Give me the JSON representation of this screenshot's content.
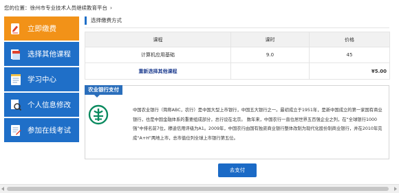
{
  "breadcrumb": {
    "label": "您的位置：",
    "current": "徐州市专业技术人员继续教育平台",
    "chevron": "›"
  },
  "sidebar": {
    "items": [
      {
        "label": "立即缴费",
        "icon": "pay-note-icon",
        "active": true
      },
      {
        "label": "选择其他课程",
        "icon": "book-icon",
        "active": false
      },
      {
        "label": "学习中心",
        "icon": "notes-icon",
        "active": false
      },
      {
        "label": "个人信息修改",
        "icon": "user-search-icon",
        "active": false
      },
      {
        "label": "参加在线考试",
        "icon": "exam-paper-icon",
        "active": false
      }
    ]
  },
  "main": {
    "section_title": "选择缴费方式",
    "table": {
      "headers": [
        "课程",
        "课时",
        "价格"
      ],
      "rows": [
        {
          "course": "计算机应用基础",
          "hours": "9.0",
          "price": "45"
        }
      ],
      "reselect_label": "重新选择其他课程",
      "total": "¥5.00"
    },
    "bank": {
      "tab_label": "农业银行支付",
      "logo_icon": "abc-bank-logo-icon",
      "description": "中国农业银行（简称ABC，农行）是中国大型上市银行，中国五大银行之一。最初成立于1951年，是新中国成立的第一家国有商业银行，也是中国金融体系的重要组成部分，总行设在北京。 数年来，中国农行一直位居世界五百强企业之列，在“全球银行1000强”中排名前7位，穆迪信用评级为A1。2009年，中国农行由国有独资商业银行整体改制为现代化股份制商业银行，并在2010年完成“A+H”两地上市，总市值位列全球上市银行第五位。"
    },
    "pay_button": "去支付"
  },
  "colors": {
    "nav_blue": "#1f6fc8",
    "nav_active_orange": "#f29218",
    "price_red": "#e2361b",
    "abc_green": "#0a8a5f"
  }
}
